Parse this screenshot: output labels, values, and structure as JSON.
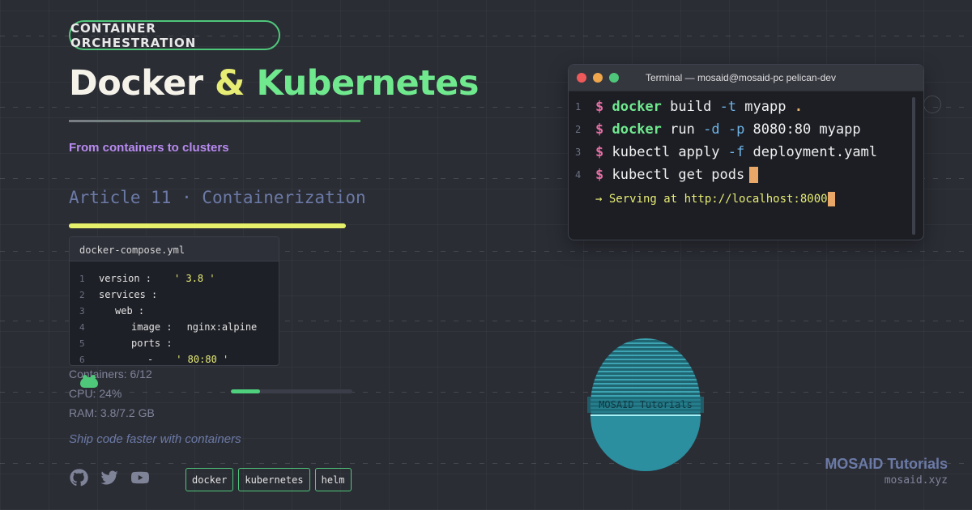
{
  "badge": "CONTAINER ORCHESTRATION",
  "title": {
    "part1": "Docker",
    "amp": " & ",
    "part2": "Kubernetes"
  },
  "subtitle": "From containers to clusters",
  "article": "Article 11 · Containerization",
  "code_file": {
    "filename": "docker-compose.yml",
    "lines": [
      {
        "n": "1",
        "key": "version :",
        "value": "' 3.8 '",
        "indent": 0,
        "is_string": true
      },
      {
        "n": "2",
        "key": "services :",
        "value": "",
        "indent": 0,
        "is_string": false
      },
      {
        "n": "3",
        "key": "web :",
        "value": "",
        "indent": 1,
        "is_string": false
      },
      {
        "n": "4",
        "key": "image :",
        "value": "nginx:alpine",
        "indent": 2,
        "is_string": false
      },
      {
        "n": "5",
        "key": "ports :",
        "value": "",
        "indent": 2,
        "is_string": false
      },
      {
        "n": "6",
        "key": "-",
        "value": "' 80:80 '",
        "indent": 3,
        "is_string": true
      }
    ]
  },
  "stats": {
    "containers": "Containers: 6/12",
    "cpu": "CPU: 24%",
    "ram": "RAM: 3.8/7.2 GB",
    "cpu_bar_percent": 24
  },
  "tagline": "Ship code faster with containers",
  "social_icons": [
    "github-icon",
    "twitter-icon",
    "youtube-icon"
  ],
  "tags": [
    "docker",
    "kubernetes",
    "helm"
  ],
  "terminal": {
    "title": "Terminal — mosaid@mosaid-pc pelican-dev",
    "dot_colors": [
      "#ee5a5a",
      "#f0a64b",
      "#4fc77a"
    ],
    "lines": [
      {
        "n": "1",
        "prompt": "$",
        "cmd": "docker",
        "rest": [
          {
            "t": " build ",
            "c": "arg"
          },
          {
            "t": "-t",
            "c": "flag"
          },
          {
            "t": " myapp ",
            "c": "arg"
          },
          {
            "t": ".",
            "c": "dotc"
          }
        ],
        "cursor": false
      },
      {
        "n": "2",
        "prompt": "$",
        "cmd": "docker",
        "rest": [
          {
            "t": " run ",
            "c": "arg"
          },
          {
            "t": "-d",
            "c": "flag"
          },
          {
            "t": " ",
            "c": "arg"
          },
          {
            "t": "-p",
            "c": "flag"
          },
          {
            "t": " 8080:80 myapp",
            "c": "arg"
          }
        ],
        "cursor": false
      },
      {
        "n": "3",
        "prompt": "$",
        "cmd": "",
        "rest": [
          {
            "t": " kubectl apply ",
            "c": "arg"
          },
          {
            "t": "-f",
            "c": "flag"
          },
          {
            "t": " deployment.yaml",
            "c": "arg"
          }
        ],
        "cursor": false
      },
      {
        "n": "4",
        "prompt": "$",
        "cmd": "",
        "rest": [
          {
            "t": " kubectl get pods",
            "c": "arg"
          }
        ],
        "cursor": true
      }
    ],
    "output": "→ Serving at http://localhost:8000"
  },
  "logo_label": "MOSAID Tutorials",
  "brand": {
    "name": "MOSAID Tutorials",
    "url": "mosaid.xyz"
  }
}
